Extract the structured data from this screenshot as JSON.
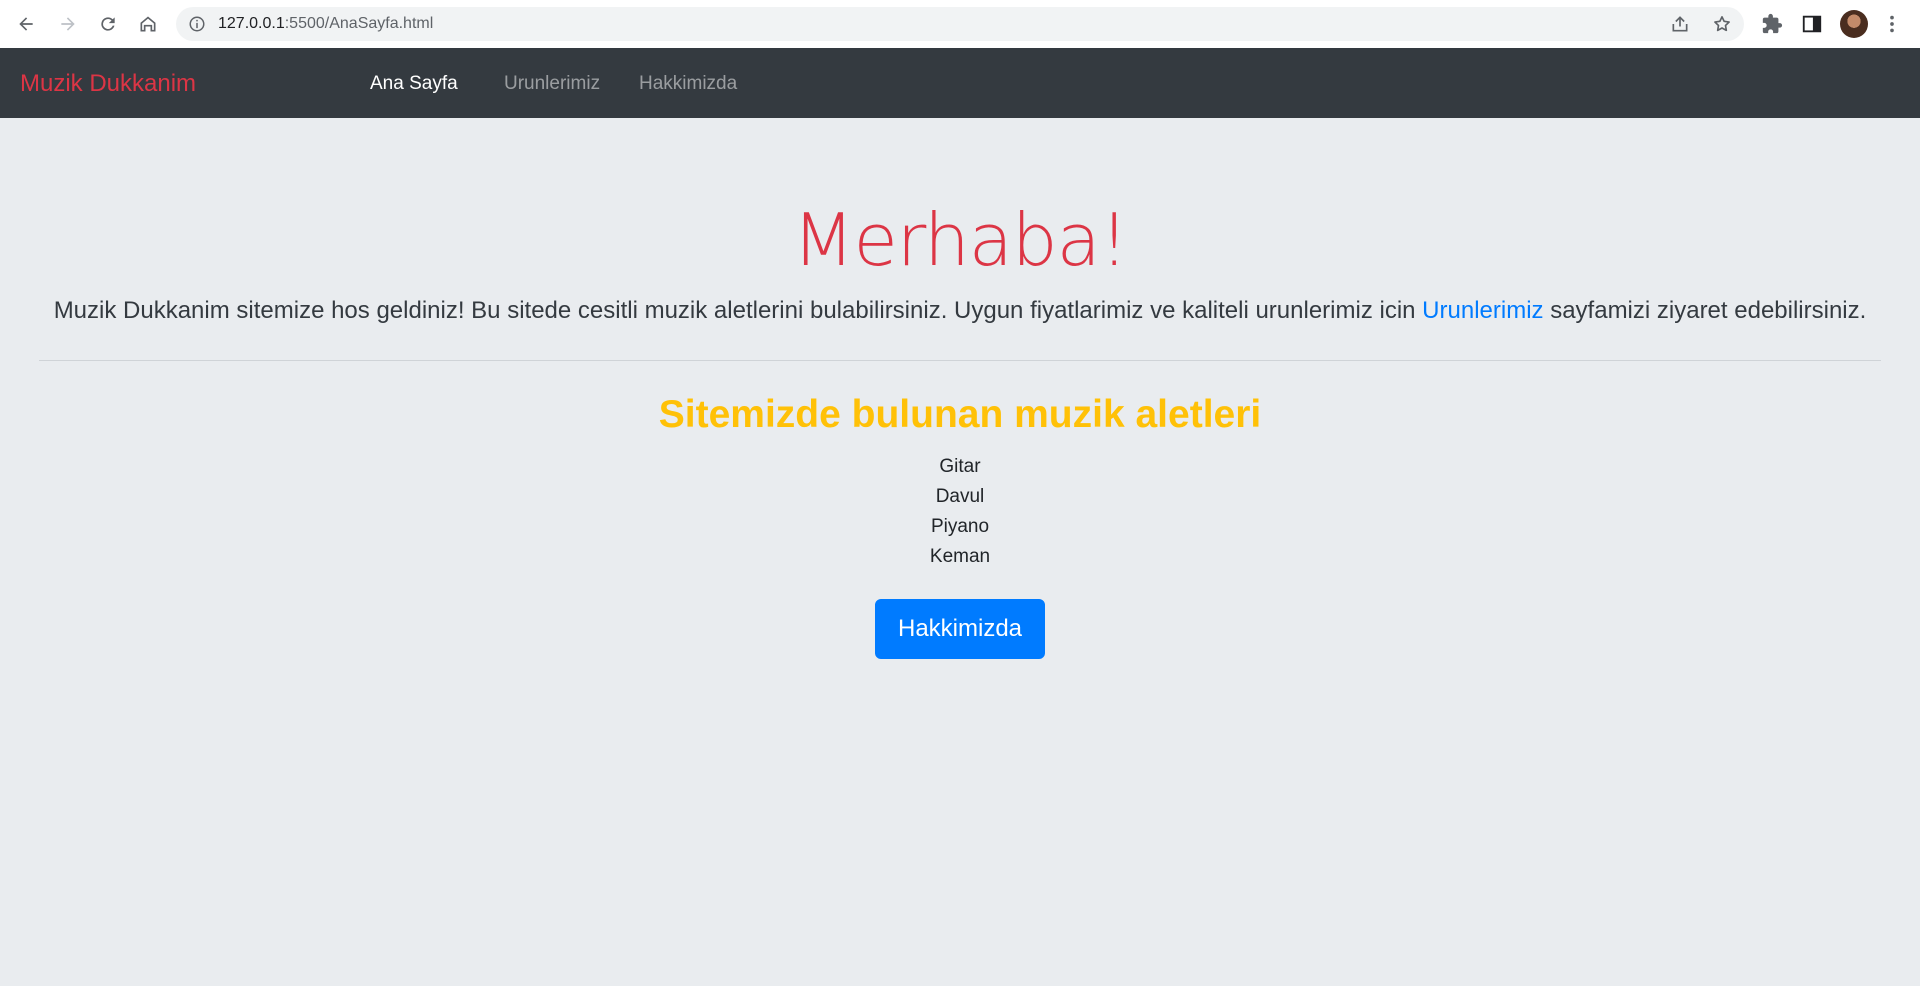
{
  "browser": {
    "url_host": "127.0.0.1",
    "url_rest": ":5500/AnaSayfa.html"
  },
  "navbar": {
    "brand": "Muzik Dukkanim",
    "links": [
      {
        "label": "Ana Sayfa",
        "active": true
      },
      {
        "label": "Urunlerimiz",
        "active": false
      },
      {
        "label": "Hakkimizda",
        "active": false
      }
    ]
  },
  "hero": {
    "title": "Merhaba!",
    "lead_before": "Muzik Dukkanim sitemize hos geldiniz! Bu sitede cesitli muzik aletlerini bulabilirsiniz. Uygun fiyatlarimiz ve kaliteli urunlerimiz icin ",
    "lead_link": "Urunlerimiz",
    "lead_after": " sayfamizi ziyaret edebilirsiniz."
  },
  "instruments": {
    "title": "Sitemizde bulunan muzik aletleri",
    "items": [
      "Gitar",
      "Davul",
      "Piyano",
      "Keman"
    ]
  },
  "cta": {
    "label": "Hakkimizda"
  },
  "colors": {
    "brand": "#dc3545",
    "navbar_bg": "#343a40",
    "page_bg": "#e9ecef",
    "section_title": "#ffc107",
    "primary": "#007bff"
  }
}
